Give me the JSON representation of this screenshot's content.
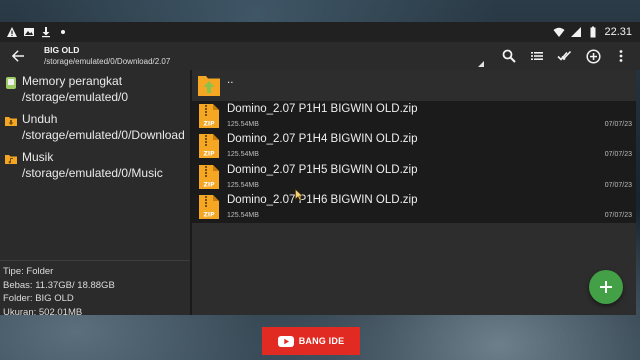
{
  "status_bar": {
    "time": "22.31",
    "left_icons": [
      "warning-icon",
      "image-icon",
      "download-icon",
      "dot-icon"
    ],
    "right_icons": [
      "wifi-icon",
      "signal-icon",
      "battery-icon"
    ]
  },
  "app_bar": {
    "title": "BIG OLD",
    "path": "/storage/emulated/0/Download/2.07",
    "actions": [
      "search-icon",
      "list-view-icon",
      "select-all-icon",
      "add-icon",
      "more-icon"
    ]
  },
  "locations": [
    {
      "name": "Memory perangkat",
      "path": "/storage/emulated/0",
      "icon": "phone-storage-icon"
    },
    {
      "name": "Unduh",
      "path": "/storage/emulated/0/Download",
      "icon": "download-folder-icon"
    },
    {
      "name": "Musik",
      "path": "/storage/emulated/0/Music",
      "icon": "music-folder-icon"
    }
  ],
  "info": {
    "type": "Tipe: Folder",
    "free": "Bebas: 11.37GB/ 18.88GB",
    "folder": "Folder: BIG OLD",
    "size": "Ukuran: 502.01MB"
  },
  "parent_label": "..",
  "files": [
    {
      "name": "Domino_2.07 P1H1 BIGWIN OLD.zip",
      "size": "125.54MB",
      "date": "07/07/23"
    },
    {
      "name": "Domino_2.07 P1H4 BIGWIN OLD.zip",
      "size": "125.54MB",
      "date": "07/07/23"
    },
    {
      "name": "Domino_2.07 P1H5 BIGWIN OLD.zip",
      "size": "125.54MB",
      "date": "07/07/23"
    },
    {
      "name": "Domino_2.07 P1H6 BIGWIN OLD.zip",
      "size": "125.54MB",
      "date": "07/07/23"
    }
  ],
  "zip_badge": "ZIP",
  "fab_icon": "plus-icon",
  "banner": {
    "text": "BANG IDE",
    "icon": "youtube-icon"
  },
  "colors": {
    "accent": "#43a047",
    "zip": "#f5a623",
    "banner": "#e12b22"
  }
}
